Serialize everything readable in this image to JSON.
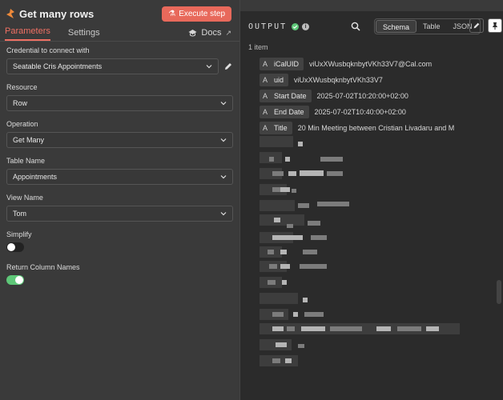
{
  "node": {
    "title": "Get many rows",
    "execute_label": "Execute step"
  },
  "tabs": [
    {
      "label": "Parameters"
    },
    {
      "label": "Settings"
    }
  ],
  "docs_label": "Docs",
  "fields": {
    "credential": {
      "label": "Credential to connect with",
      "value": "Seatable Cris Appointments"
    },
    "resource": {
      "label": "Resource",
      "value": "Row"
    },
    "operation": {
      "label": "Operation",
      "value": "Get Many"
    },
    "table_name": {
      "label": "Table Name",
      "value": "Appointments"
    },
    "view_name": {
      "label": "View Name",
      "value": "Tom"
    },
    "simplify": {
      "label": "Simplify",
      "value": false
    },
    "return_column_names": {
      "label": "Return Column Names",
      "value": true
    }
  },
  "output": {
    "title": "OUTPUT",
    "item_count": "1 item",
    "views": [
      "Schema",
      "Table",
      "JSON"
    ],
    "active_view": "Schema",
    "schema_rows": [
      {
        "type": "A",
        "key": "iCalUID",
        "value": "viUxXWusbqknbytVKh33V7@Cal.com"
      },
      {
        "type": "A",
        "key": "uid",
        "value": "viUxXWusbqknbytVKh33V7"
      },
      {
        "type": "A",
        "key": "Start Date",
        "value": "2025-07-02T10:20:00+02:00"
      },
      {
        "type": "A",
        "key": "End Date",
        "value": "2025-07-02T10:40:00+02:00"
      },
      {
        "type": "A",
        "key": "Title",
        "value": "20 Min Meeting between Cristian Livadaru and M"
      }
    ]
  },
  "colors": {
    "accent": "#ef7063",
    "execute_button": "#e8695b",
    "success": "#5ec778"
  },
  "icons": [
    "node-icon",
    "flask-icon",
    "docs-cap-icon",
    "external-link-icon",
    "chevron-down-icon",
    "pencil-icon",
    "success-check-icon",
    "info-icon",
    "search-icon",
    "edit-icon",
    "pin-icon"
  ]
}
